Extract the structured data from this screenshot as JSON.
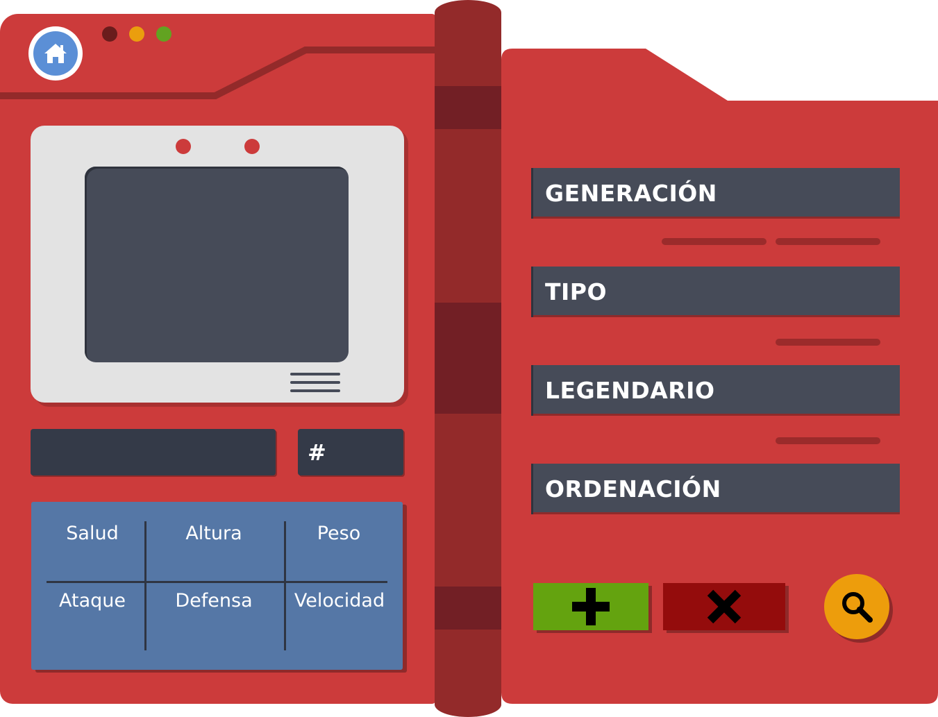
{
  "colors": {
    "body_red": "#cc3b3b",
    "spine": "#932a2a",
    "field_dark": "#464b58",
    "stats_blue": "#5577a6",
    "add_green": "#64a30f",
    "clear_red": "#940c0c",
    "search_orange": "#ed9d0c",
    "home_blue": "#5b8fd6"
  },
  "window_dots": [
    {
      "name": "dark-red-dot",
      "color": "#6a1c1c"
    },
    {
      "name": "orange-dot",
      "color": "#ea9e0e"
    },
    {
      "name": "green-dot",
      "color": "#62a321"
    }
  ],
  "icons": {
    "home": "home-icon",
    "add": "plus-icon",
    "clear": "x-icon",
    "search": "search-icon"
  },
  "number_field": {
    "label": "#"
  },
  "stats": {
    "row1": [
      "Salud",
      "Altura",
      "Peso"
    ],
    "row2": [
      "Ataque",
      "Defensa",
      "Velocidad"
    ]
  },
  "filters": [
    {
      "label": "GENERACIÓN"
    },
    {
      "label": "TIPO"
    },
    {
      "label": "LEGENDARIO"
    },
    {
      "label": "ORDENACIÓN"
    }
  ]
}
